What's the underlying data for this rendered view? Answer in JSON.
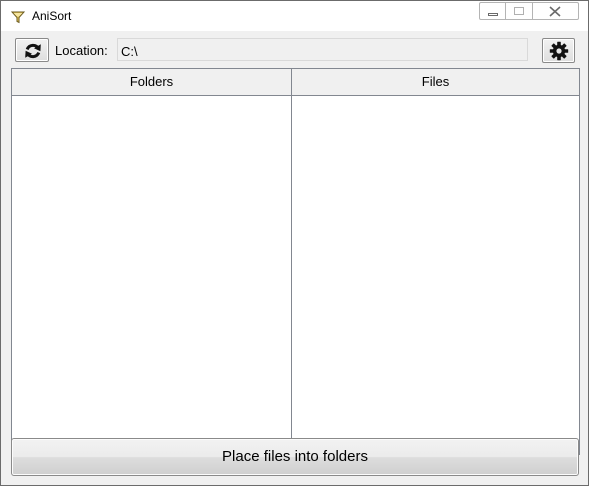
{
  "window": {
    "title": "AniSort"
  },
  "toolbar": {
    "refresh_icon": "refresh-icon",
    "location_label": "Location:",
    "location_value": "C:\\",
    "settings_icon": "gear-icon"
  },
  "lists": {
    "folders_header": "Folders",
    "files_header": "Files",
    "folders": [],
    "files": []
  },
  "actions": {
    "place_label": "Place files into folders"
  }
}
